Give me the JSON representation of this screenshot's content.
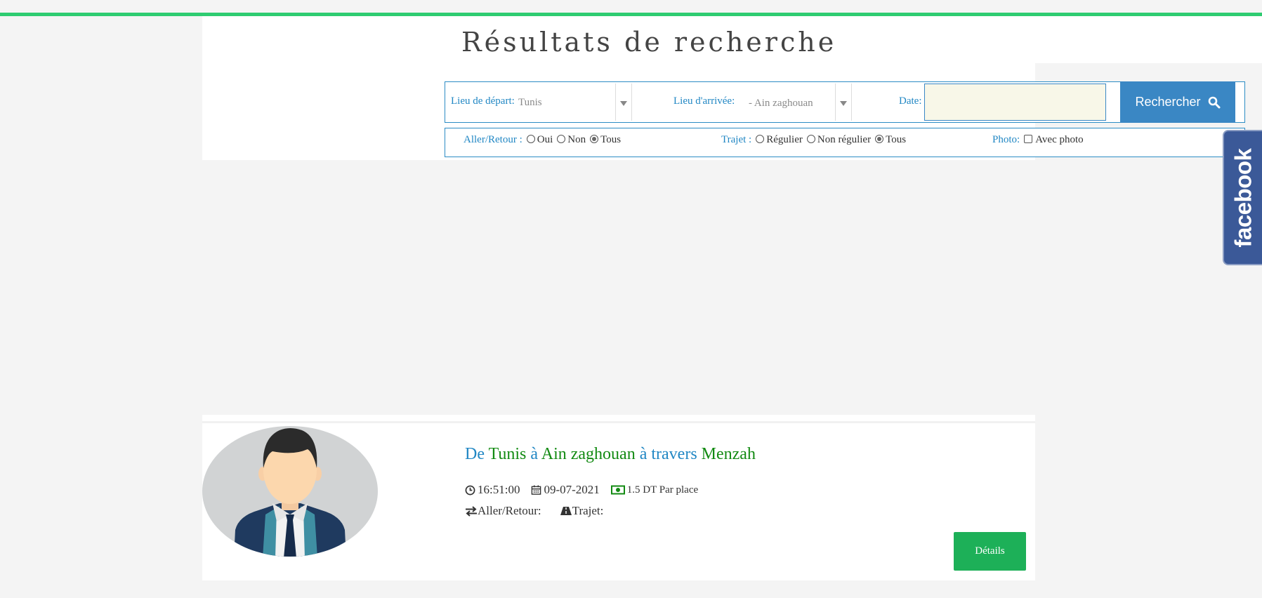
{
  "header": {
    "title": "Résultats de recherche"
  },
  "search": {
    "departure_label": "Lieu de départ:",
    "departure_value": "Tunis",
    "arrival_label": "Lieu d'arrivée:",
    "arrival_value": "- Ain zaghouan",
    "date_label": "Date:",
    "date_value": "",
    "button_label": "Rechercher"
  },
  "filters": {
    "round_trip": {
      "label": "Aller/Retour :",
      "options": [
        "Oui",
        "Non",
        "Tous"
      ],
      "selected": "Tous"
    },
    "route": {
      "label": "Trajet :",
      "options": [
        "Régulier",
        "Non régulier",
        "Tous"
      ],
      "selected": "Tous"
    },
    "photo": {
      "label": "Photo:",
      "checkbox_label": "Avec photo",
      "checked": false
    }
  },
  "facebook_tab": {
    "label": "facebook"
  },
  "results": [
    {
      "title_parts": [
        "De",
        "Tunis",
        "à",
        "Ain zaghouan",
        "à travers",
        "Menzah"
      ],
      "time": "16:51:00",
      "date": "09-07-2021",
      "price": "1.5 DT Par place",
      "round_trip_label": "Aller/Retour:",
      "route_label": "Trajet:",
      "details_label": "Détails"
    }
  ],
  "colors": {
    "accent_green": "#2ecc71",
    "link_blue": "#2187c4",
    "place_green": "#128a12",
    "button_blue": "#3a87c4",
    "details_green": "#1db058",
    "facebook_blue": "#3b5998"
  }
}
